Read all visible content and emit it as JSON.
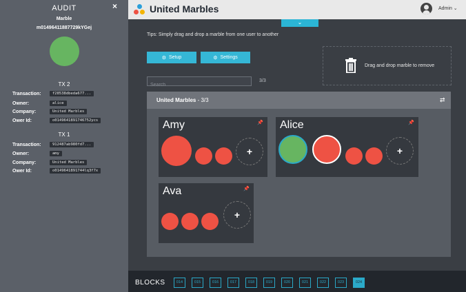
{
  "audit": {
    "title": "AUDIT",
    "close": "×",
    "marble_label": "Marble",
    "marble_id": "m01496411887729kYGej",
    "tx": [
      {
        "title": "TX 2",
        "rows": [
          {
            "label": "Transaction:",
            "value": "f28538dbeda677..."
          },
          {
            "label": "Owner:",
            "value": "alice"
          },
          {
            "label": "Company:",
            "value": "United Marbles"
          },
          {
            "label": "Ower Id:",
            "value": "o0149641891746752ycs"
          }
        ]
      },
      {
        "title": "TX 1",
        "rows": [
          {
            "label": "Transaction:",
            "value": "912487ab980fd7..."
          },
          {
            "label": "Owner:",
            "value": "amy"
          },
          {
            "label": "Company:",
            "value": "United Marbles"
          },
          {
            "label": "Ower Id:",
            "value": "o0149641891744lq3f7x"
          }
        ]
      }
    ]
  },
  "header": {
    "title": "United Marbles",
    "user": "Admin"
  },
  "tips": "Tips: Simply drag and drop a marble from one user to another",
  "buttons": {
    "setup": "Setup",
    "settings": "Settings"
  },
  "search": {
    "placeholder": "Search",
    "count": "3/3"
  },
  "trash": {
    "label": "Drag and drop marble to remove"
  },
  "panel": {
    "title": "United Marbles",
    "count": "- 3/3"
  },
  "users": [
    {
      "name": "Amy"
    },
    {
      "name": "Alice"
    },
    {
      "name": "Ava"
    }
  ],
  "colors": {
    "accent": "#35b7d6",
    "marble_red": "#ee5244",
    "marble_green": "#67b561"
  },
  "blocks": {
    "label": "BLOCKS",
    "items": [
      "014",
      "015",
      "016",
      "017",
      "018",
      "019",
      "020",
      "021",
      "022",
      "023",
      "024"
    ],
    "active": "024"
  }
}
